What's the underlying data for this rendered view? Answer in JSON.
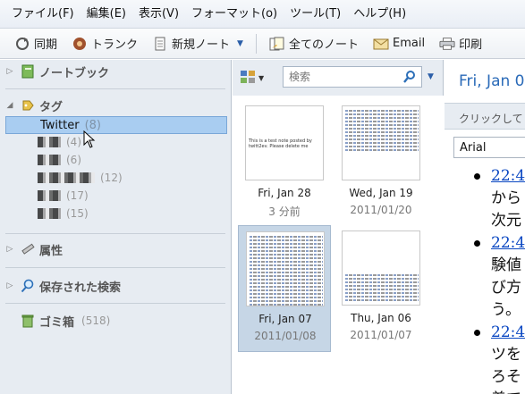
{
  "menubar": {
    "items": [
      "ファイル(F)",
      "編集(E)",
      "表示(V)",
      "フォーマット(o)",
      "ツール(T)",
      "ヘルプ(H)"
    ]
  },
  "toolbar": {
    "sync": "同期",
    "trunk": "トランク",
    "new_note": "新規ノート",
    "all_notes": "全てのノート",
    "email": "Email",
    "print": "印刷"
  },
  "sidebar": {
    "notebook": "ノートブック",
    "tags": "タグ",
    "attributes": "属性",
    "saved_searches": "保存された検索",
    "trash": "ゴミ箱",
    "trash_count": "(518)",
    "tag_selected": {
      "name": "Twitter",
      "count": "(8)"
    },
    "other_tags": [
      {
        "count": "(4)"
      },
      {
        "count": "(6)"
      },
      {
        "count": "(12)"
      },
      {
        "count": "(17)"
      },
      {
        "count": "(15)"
      }
    ]
  },
  "thumbs": {
    "search_placeholder": "検索",
    "items": [
      {
        "date": "Fri, Jan 28",
        "sub": "3 分前",
        "snippet": "This is a test note posted by twitt2ev. Please delete me"
      },
      {
        "date": "Wed, Jan 19",
        "sub": "2011/01/20"
      },
      {
        "date": "Fri, Jan 07",
        "sub": "2011/01/08"
      },
      {
        "date": "Thu, Jan 06",
        "sub": "2011/01/07"
      }
    ]
  },
  "note": {
    "title": "Fri, Jan 0",
    "click_hint": "クリックして",
    "font": "Arial",
    "items": [
      {
        "time": "22:4",
        "lines": [
          "から",
          "次元"
        ]
      },
      {
        "time": "22:4",
        "lines": [
          "験値",
          "び方",
          "う。"
        ]
      },
      {
        "time": "22:4",
        "lines": [
          "ツを",
          "ろそ",
          "着て"
        ]
      }
    ]
  },
  "colors": {
    "selection": "#a9cdf1",
    "link": "#0a47c2",
    "title_blue": "#2a6ab8"
  }
}
